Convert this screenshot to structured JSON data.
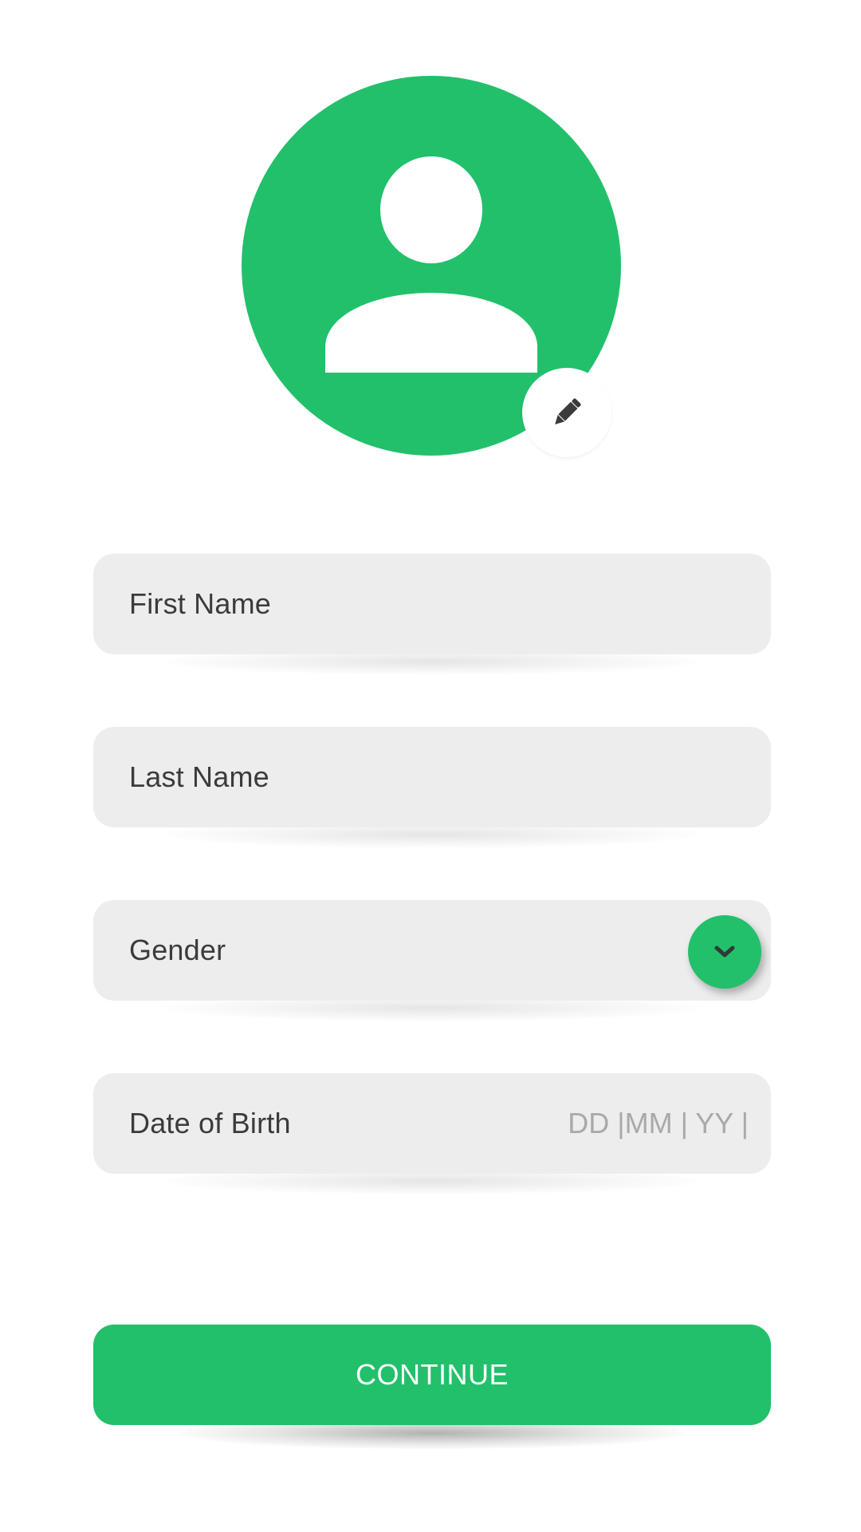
{
  "colors": {
    "accent": "#22c06b",
    "field_bg": "#ededed",
    "text": "#3b3b3b",
    "placeholder": "#a9a9a9",
    "button_text": "#ffffff"
  },
  "avatar": {
    "icon": "person-icon",
    "edit_icon": "pencil-icon"
  },
  "form": {
    "first_name": {
      "placeholder": "First Name"
    },
    "last_name": {
      "placeholder": "Last Name"
    },
    "gender": {
      "placeholder": "Gender",
      "icon": "chevron-down-icon"
    },
    "dob": {
      "label": "Date of Birth",
      "format_hint": "DD |MM | YY |"
    }
  },
  "actions": {
    "continue_label": "CONTINUE"
  }
}
